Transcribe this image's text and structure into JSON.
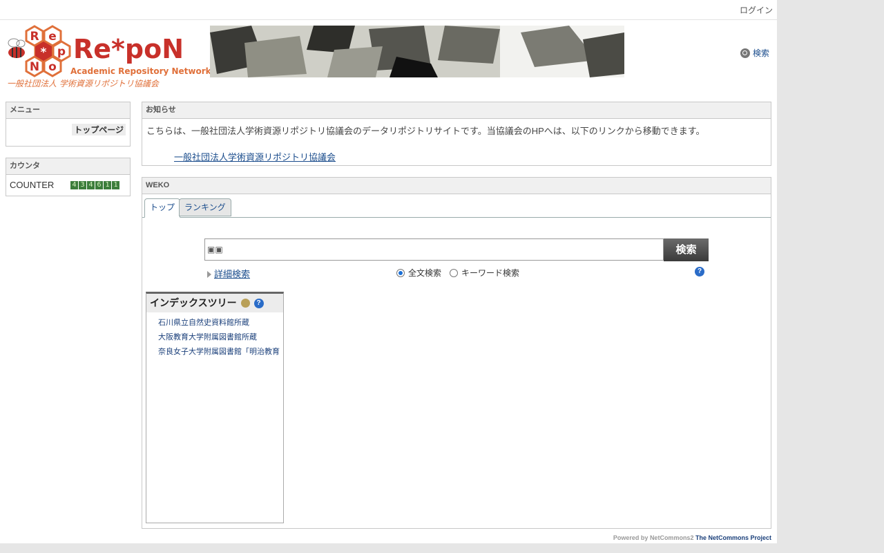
{
  "header": {
    "login_label": "ログイン",
    "search_label": "検索",
    "logo": {
      "brand": "Re*poN",
      "subtitle": "Academic Repository Network",
      "org": "一般社団法人 学術資源リポジトリ協議会",
      "hex_letters": [
        "R",
        "e",
        "p",
        "o",
        "N",
        "*"
      ]
    }
  },
  "menu": {
    "title": "メニュー",
    "items": [
      {
        "label": "トップページ"
      }
    ]
  },
  "counter": {
    "title": "カウンタ",
    "label": "COUNTER",
    "digits": [
      "4",
      "3",
      "4",
      "6",
      "1",
      "1"
    ]
  },
  "notice": {
    "title": "お知らせ",
    "text": "こちらは、一般社団法人学術資源リポジトリ協議会のデータリポジトリサイトです。当協議会のHPへは、以下のリンクから移動できます。",
    "link": "一般社団法人学術資源リポジトリ協議会"
  },
  "weko": {
    "title": "WEKO",
    "tabs": [
      {
        "label": "トップ",
        "active": true
      },
      {
        "label": "ランキング",
        "active": false
      }
    ],
    "search": {
      "value": "",
      "button": "検索",
      "advanced": "詳細検索",
      "modes": [
        {
          "label": "全文検索",
          "selected": true
        },
        {
          "label": "キーワード検索",
          "selected": false
        }
      ],
      "help": "?"
    },
    "index_tree": {
      "title": "インデックスツリー",
      "help": "?",
      "items": [
        {
          "label": "石川県立自然史資料館所蔵"
        },
        {
          "label": "大阪教育大学附属図書館所蔵"
        },
        {
          "label": "奈良女子大学附属図書館「明治教育"
        }
      ]
    }
  },
  "footer": {
    "powered": "Powered by NetCommons2",
    "project": "The NetCommons Project"
  },
  "colors": {
    "link": "#1a4c8c",
    "logo_red": "#c8302a",
    "logo_orange": "#e0703a",
    "counter_green": "#3c7d3c"
  }
}
